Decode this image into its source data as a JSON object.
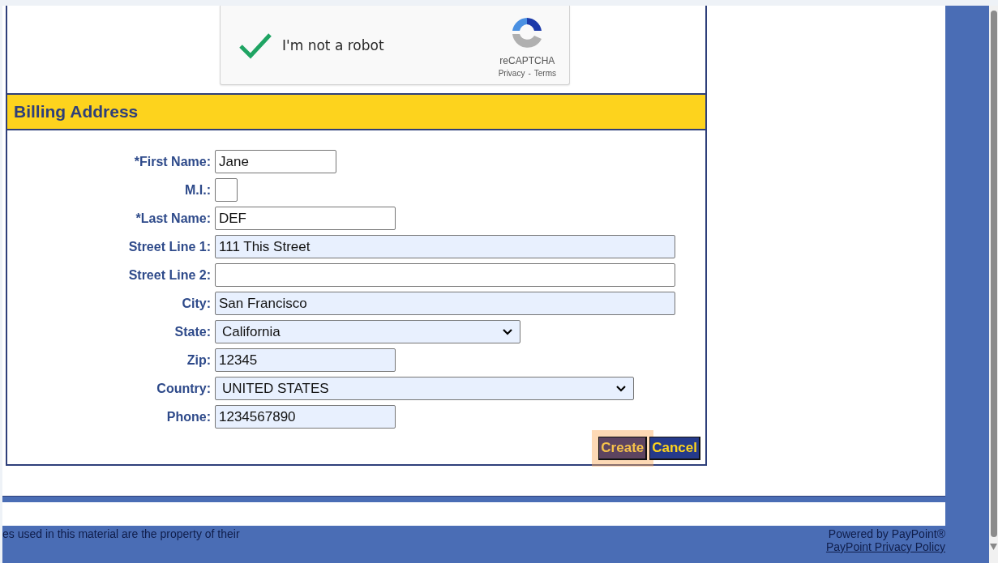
{
  "captcha": {
    "label": "I'm not a robot",
    "checked": true,
    "brand": "reCAPTCHA",
    "privacy": "Privacy",
    "separator": "-",
    "terms": "Terms"
  },
  "section": {
    "title": "Billing Address"
  },
  "fields": [
    {
      "kind": "text",
      "label": "*First Name:",
      "value": "Jane",
      "autofilled": false
    },
    {
      "kind": "text",
      "label": "M.I.:",
      "autofilled": false
    },
    {
      "kind": "text",
      "label": "*Last Name:",
      "value": "DEF",
      "autofilled": false
    },
    {
      "kind": "text",
      "label": "Street Line 1:",
      "value": "111 This Street",
      "autofilled": true
    },
    {
      "kind": "text",
      "label": "Street Line 2:",
      "autofilled": false
    },
    {
      "kind": "text",
      "label": "City:",
      "value": "San Francisco",
      "autofilled": true
    },
    {
      "kind": "select",
      "label": "State:",
      "value": "California",
      "autofilled": true
    },
    {
      "kind": "text",
      "label": "Zip:",
      "value": "12345",
      "autofilled": true
    },
    {
      "kind": "select",
      "label": "Country:",
      "value": "UNITED STATES",
      "autofilled": true
    },
    {
      "kind": "text",
      "label": "Phone:",
      "value": "1234567890",
      "autofilled": true
    }
  ],
  "buttons": [
    {
      "label": "Create",
      "highlighted": true
    },
    {
      "label": "Cancel",
      "highlighted": false
    }
  ],
  "footer": {
    "notice": "es used in this material are the property of their",
    "powered": "Powered by PayPoint®",
    "policy_link": "PayPoint Privacy Policy"
  }
}
